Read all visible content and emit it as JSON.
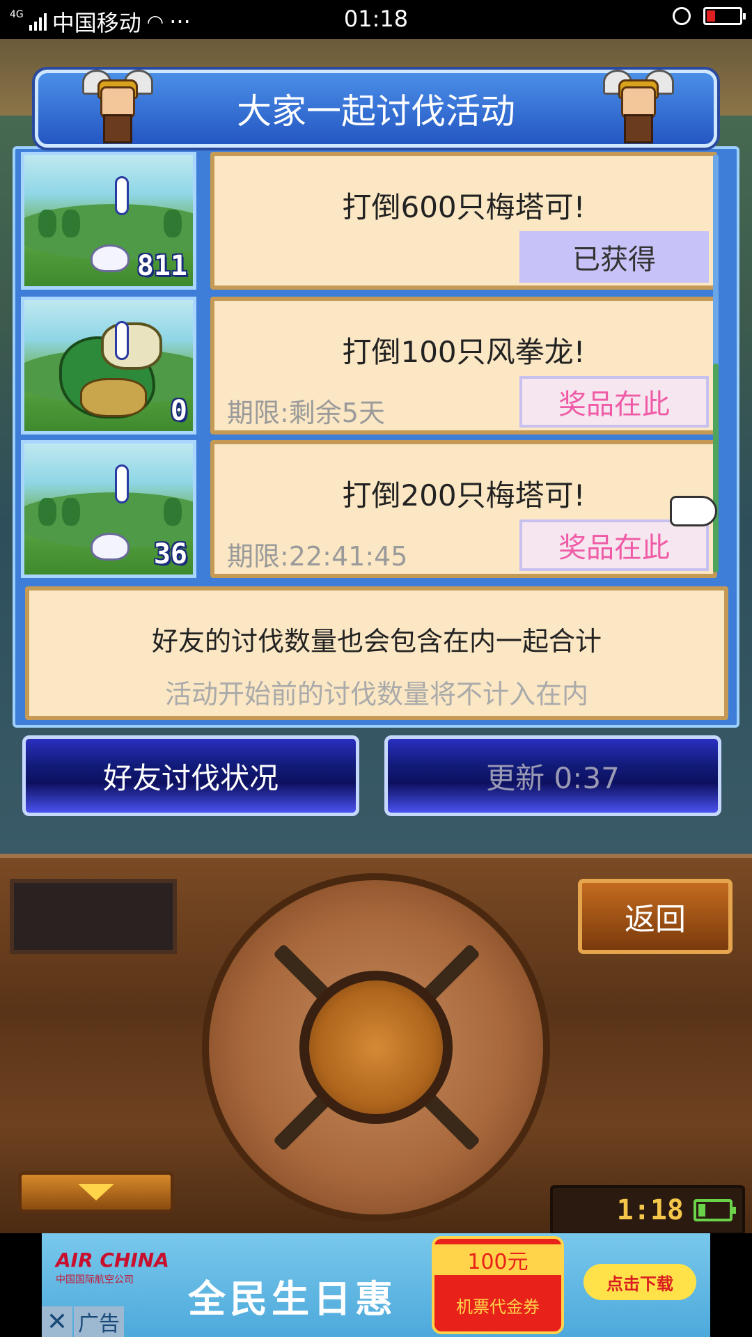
{
  "status_bar": {
    "network": "4G",
    "carrier": "中国移动",
    "more": "···",
    "time": "01:18"
  },
  "dialog": {
    "title": "大家一起讨伐活动",
    "missions": [
      {
        "text": "打倒600只梅塔可!",
        "deadline": "",
        "reward_label": "已获得",
        "reward_state": "claimed",
        "count": "811",
        "monster": "rabbit"
      },
      {
        "text": "打倒100只风拳龙!",
        "deadline": "期限:剩余5天",
        "reward_label": "奖品在此",
        "reward_state": "available",
        "count": "0",
        "monster": "dragon"
      },
      {
        "text": "打倒200只梅塔可!",
        "deadline": "期限:22:41:45",
        "reward_label": "奖品在此",
        "reward_state": "available",
        "count": "36",
        "monster": "rabbit"
      }
    ],
    "note_main": "好友的讨伐数量也会包含在内一起合计",
    "note_sub": "活动开始前的讨伐数量将不计入在内",
    "friend_status_button": "好友讨伐状况",
    "refresh_button": "更新 0:37"
  },
  "controller": {
    "back_button": "返回",
    "clock": "1:18"
  },
  "ad": {
    "brand": "AIR CHINA",
    "brand_cn": "中国国际航空公司",
    "slogan": "全民生日惠",
    "coupon_amount": "100元",
    "coupon_text": "机票代金券",
    "cta": "点击下载",
    "close": "✕",
    "tag": "广告"
  },
  "colors": {
    "panel": "#3e7ed8",
    "card": "#fbe7c4",
    "reward_claimed": "#c7c2f7",
    "reward_available_text": "#ef5ba6"
  }
}
